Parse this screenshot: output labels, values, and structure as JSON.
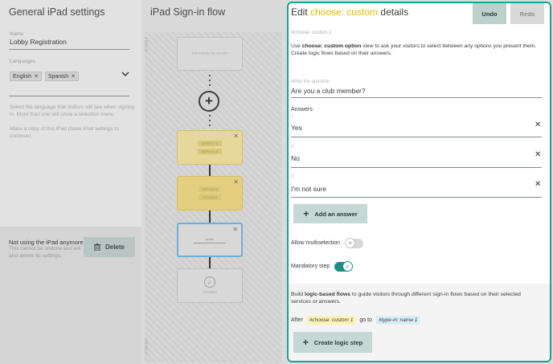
{
  "left_panel": {
    "title": "General iPad settings",
    "name_label": "Name",
    "name_value": "Lobby Registration",
    "languages_label": "Languages",
    "languages": [
      "English",
      "Spanish"
    ],
    "language_help": "Select the language that visitors will see when signing in. More than one will show a selection menu.",
    "copy_help": "Make a copy of this iPad (Save iPad settings to continue)",
    "delete_title": "Not using the iPad anymore?",
    "delete_subtitle": "This cannot be undone and will also delete its settings.",
    "delete_label": "Delete"
  },
  "flow_panel": {
    "title": "iPad Sign-in flow",
    "start_label": "START",
    "finish_label": "FINISH",
    "start_node_text": "TAP HERE TO START",
    "service_tags": [
      "SERVICE A",
      "SERVICE B"
    ],
    "option_tags": [
      "OPTION A",
      "OPTION B"
    ],
    "blue_node_text": "prefix",
    "end_node_text": "THANKS"
  },
  "editor": {
    "title_prefix": "Edit ",
    "title_highlight": "choose: custom",
    "title_suffix": " details",
    "undo_label": "Undo",
    "redo_label": "Redo",
    "tag": "#choose: custom 1",
    "desc_pre": "Use ",
    "desc_bold": "choose: custom option",
    "desc_post": " view to ask your visitors to select between any options you present them. Create logic flows based on their answers.",
    "question_label": "Write the question",
    "question_value": "Are you a club member?",
    "answers_label": "Answers",
    "answers": [
      {
        "index": "1",
        "value": "Yes"
      },
      {
        "index": "2",
        "value": "No"
      },
      {
        "index": "3",
        "value": "I'm not sure"
      }
    ],
    "add_answer_label": "Add an answer",
    "multiselect_label": "Allow multiselection",
    "multiselect_on": false,
    "mandatory_label": "Mandatory step",
    "mandatory_on": true,
    "logic_pre": "Build ",
    "logic_bold": "logic-based flows",
    "logic_post": " to guide visitors through different sign-in flows based on their selected services or answers.",
    "after_label": "After",
    "after_source": "#choose: custom 1",
    "goto_label": "go to",
    "goto_target": "#type-in: name 1",
    "create_logic_label": "Create logic step"
  },
  "colors": {
    "accent": "#19a195",
    "highlight_yellow": "#e8b700",
    "button_bg": "#c5d8d3"
  },
  "icons": {
    "remove_chip": "close-icon",
    "languages_dropdown": "chevron-down-icon",
    "delete": "trash-icon",
    "add": "plus-icon",
    "remove_answer": "close-icon"
  }
}
